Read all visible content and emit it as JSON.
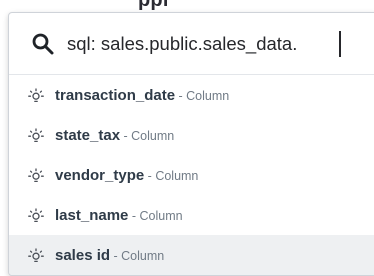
{
  "background_fragment": "ppl",
  "search": {
    "value": "sql: sales.public.sales_data.",
    "icon": "search-icon"
  },
  "results": [
    {
      "name": "transaction_date",
      "separator": " - ",
      "type": "Column",
      "icon": "lightbulb-icon",
      "selected": false
    },
    {
      "name": "state_tax",
      "separator": " - ",
      "type": "Column",
      "icon": "lightbulb-icon",
      "selected": false
    },
    {
      "name": "vendor_type",
      "separator": " - ",
      "type": "Column",
      "icon": "lightbulb-icon",
      "selected": false
    },
    {
      "name": "last_name",
      "separator": " - ",
      "type": "Column",
      "icon": "lightbulb-icon",
      "selected": false
    },
    {
      "name": "sales id",
      "separator": " - ",
      "type": "Column",
      "icon": "lightbulb-icon",
      "selected": true
    }
  ],
  "colors": {
    "text_primary": "#2f3b48",
    "text_secondary": "#717b86",
    "selected_row": "#eef0f2",
    "border": "#cfd3d9"
  }
}
